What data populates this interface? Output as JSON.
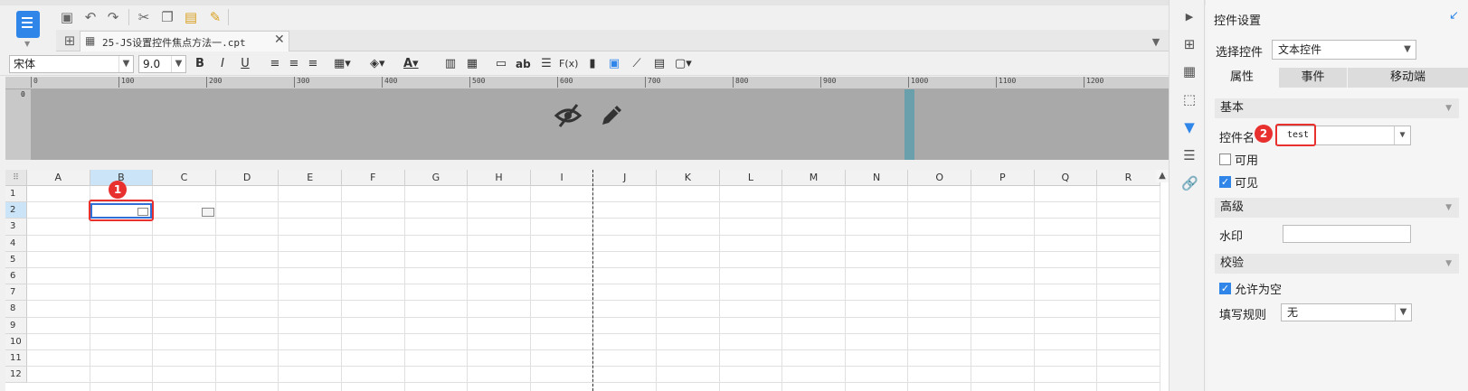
{
  "document": {
    "tab_label": "25-JS设置控件焦点方法一.cpt",
    "close_glyph": "✕"
  },
  "format_toolbar": {
    "font_name": "宋体",
    "font_size": "9.0",
    "bold": "B",
    "italic": "I",
    "underline": "U",
    "text_ab": "ab",
    "formula": "F(x)"
  },
  "ruler": {
    "ticks": [
      "0",
      "100",
      "200",
      "300",
      "400",
      "500",
      "600",
      "700",
      "800",
      "900",
      "1000",
      "1100",
      "1200"
    ],
    "vertical_zero": "0"
  },
  "grid": {
    "columns": [
      "A",
      "B",
      "C",
      "D",
      "E",
      "F",
      "G",
      "H",
      "I",
      "J",
      "K",
      "L",
      "M",
      "N",
      "O",
      "P",
      "Q",
      "R"
    ],
    "rows": [
      "1",
      "2",
      "3",
      "4",
      "5",
      "6",
      "7",
      "8",
      "9",
      "10",
      "11",
      "12"
    ],
    "selected_column": "B",
    "selected_row": "2",
    "annotation_1": "1"
  },
  "panel": {
    "title": "控件设置",
    "select_label": "选择控件",
    "select_value": "文本控件",
    "tabs": [
      "属性",
      "事件",
      "移动端"
    ],
    "active_tab": "属性",
    "section_basic": "基本",
    "name_label": "控件名",
    "name_value": "test",
    "annotation_2": "2",
    "enabled_label": "可用",
    "enabled_checked": false,
    "visible_label": "可见",
    "visible_checked": true,
    "section_advanced": "高级",
    "watermark_label": "水印",
    "watermark_value": "",
    "section_validation": "校验",
    "allow_empty_label": "允许为空",
    "allow_empty_checked": true,
    "rule_label": "填写规则",
    "rule_value": "无"
  },
  "colors": {
    "accent": "#2f86e8",
    "highlight": "#e8312e",
    "selection": "#cce4f7"
  }
}
